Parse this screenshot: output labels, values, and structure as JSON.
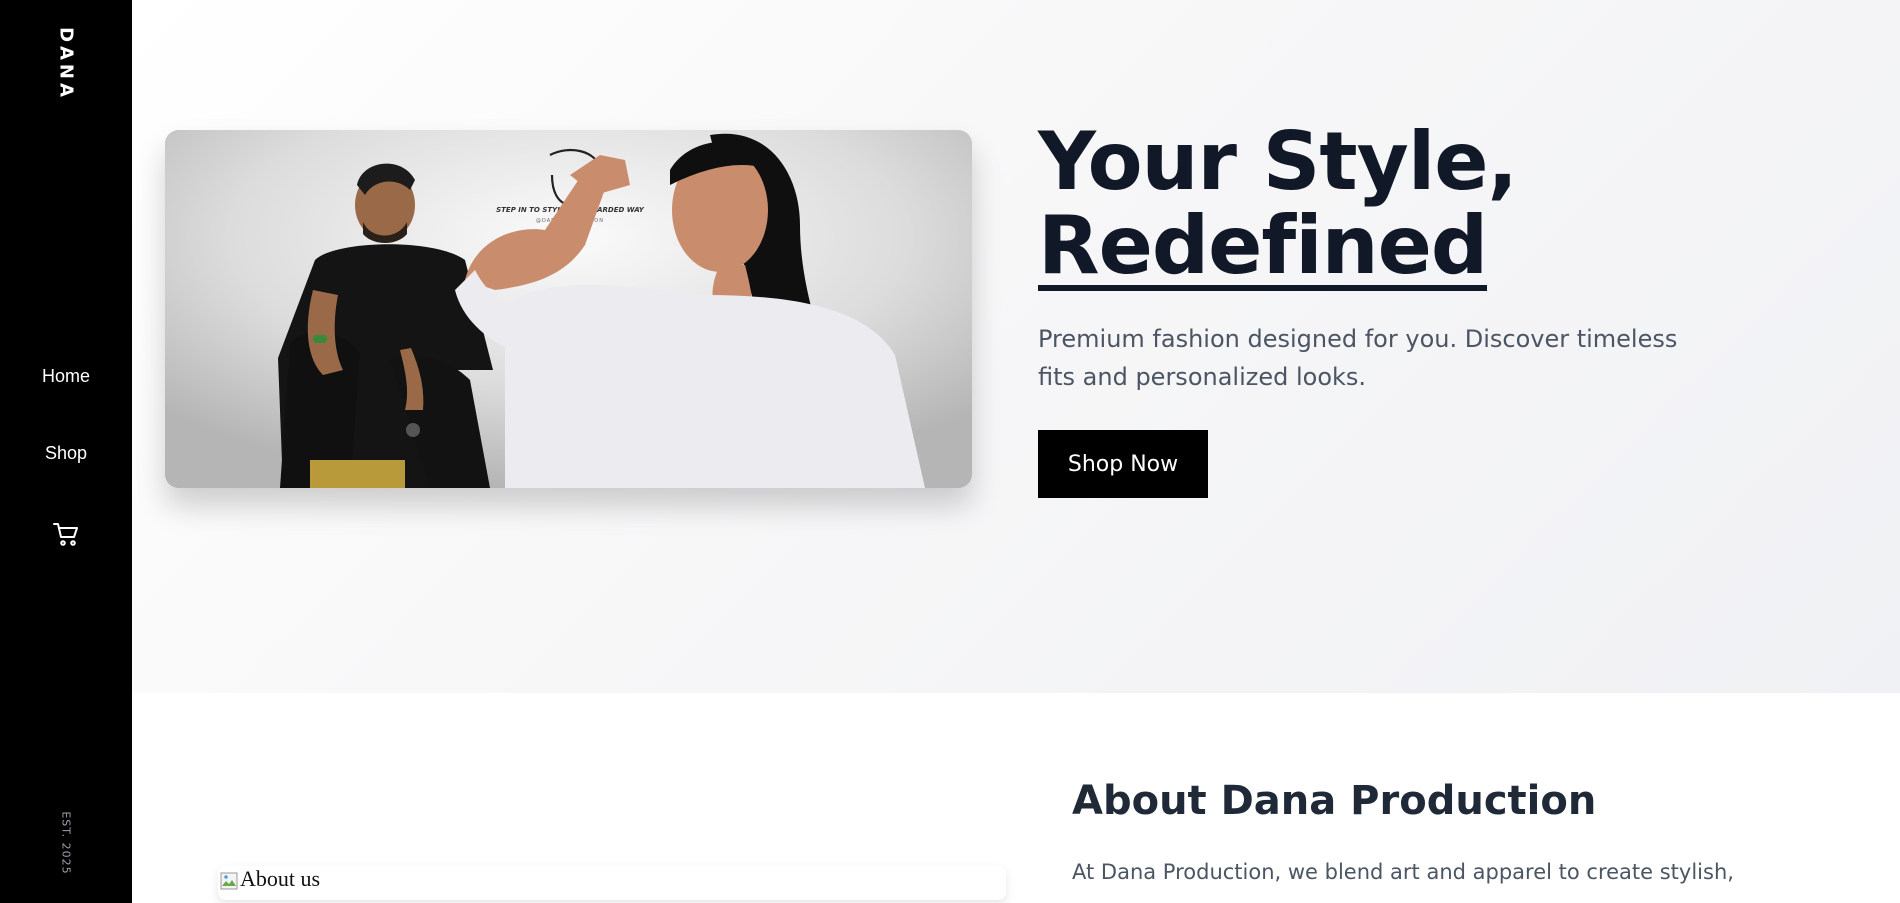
{
  "sidebar": {
    "brand": "DANA",
    "nav": [
      {
        "label": "Home"
      },
      {
        "label": "Shop"
      }
    ],
    "cart_icon": "cart-icon",
    "established": "EST. 2025"
  },
  "hero": {
    "title_line1": "Your Style,",
    "title_line2": "Redefined",
    "subtitle": "Premium fashion designed for you. Discover timeless fits and personalized looks.",
    "cta_label": "Shop Now",
    "image": {
      "logo_tagline": "STEP IN TO STYLE,THE BEARDED WAY",
      "logo_handle": "@DANAPRODUCTION"
    }
  },
  "about": {
    "title": "About Dana Production",
    "text": "At Dana Production, we blend art and apparel to create stylish,",
    "image_alt": "About us"
  },
  "colors": {
    "sidebar_bg": "#000000",
    "heading": "#111827",
    "body_text": "#4b5563",
    "button_bg": "#000000"
  }
}
